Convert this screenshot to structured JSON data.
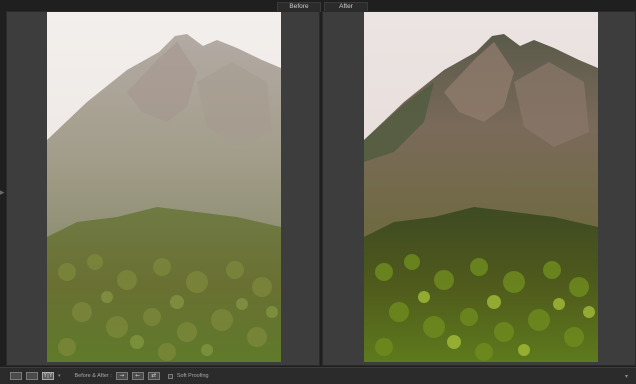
{
  "labels": {
    "before": "Before",
    "after": "After"
  },
  "toolbar": {
    "loupe_view_icon": "single-view-icon",
    "compare_view_icon": "compare-view-icon",
    "before_after_view_icon": "before-after-view-icon",
    "before_after_view_glyph": "Y|Y",
    "before_after_label": "Before & After :",
    "copy_before_settings_icon": "copy-before-to-after-icon",
    "copy_after_settings_icon": "copy-after-to-before-icon",
    "swap_icon": "swap-icon",
    "soft_proofing_label": "Soft Proofing",
    "soft_proofing_checked": false
  },
  "colors": {
    "background": "#1f1f1f",
    "pane": "#3d3d3d",
    "toolbar": "#2b2b2b"
  }
}
